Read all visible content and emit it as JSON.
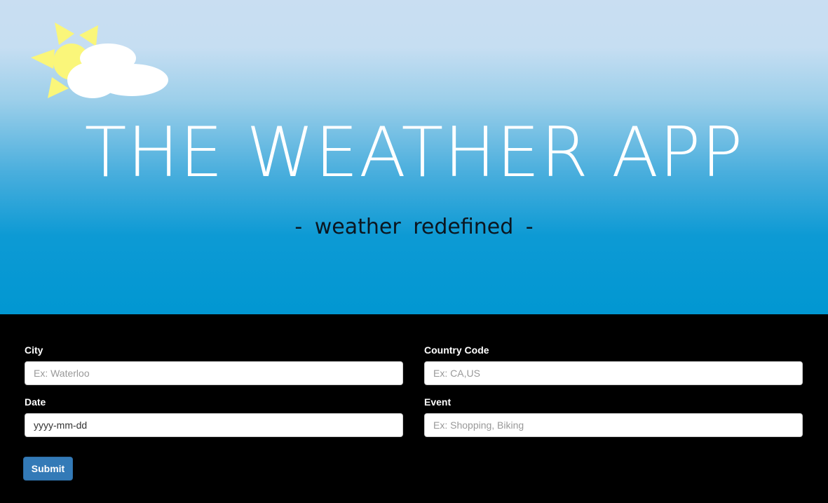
{
  "header": {
    "title": "THE WEATHER APP",
    "subtitle": "- weather redefined -",
    "logo_icon": "sun-behind-cloud-icon"
  },
  "form": {
    "city": {
      "label": "City",
      "placeholder": "Ex: Waterloo",
      "value": ""
    },
    "country_code": {
      "label": "Country Code",
      "placeholder": "Ex: CA,US",
      "value": ""
    },
    "date": {
      "label": "Date",
      "value": "yyyy-mm-dd"
    },
    "event": {
      "label": "Event",
      "placeholder": "Ex: Shopping, Biking",
      "value": ""
    },
    "submit_label": "Submit"
  },
  "colors": {
    "sky_top": "#c9def2",
    "sky_bottom": "#0197d2",
    "sun": "#faf67a",
    "form_background": "#000000",
    "submit_button": "#337ab7"
  }
}
